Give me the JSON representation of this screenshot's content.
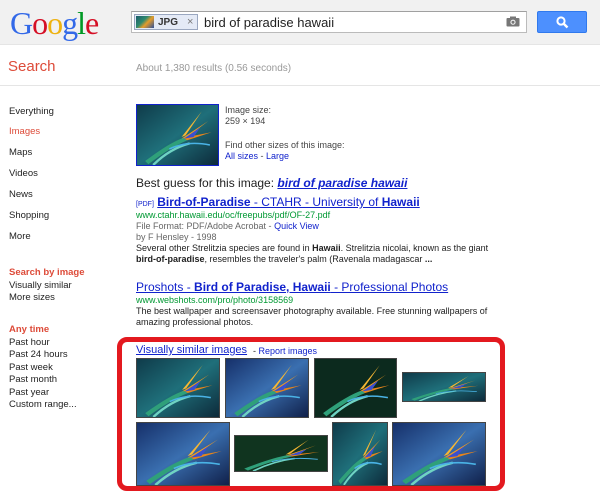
{
  "header": {
    "logo_letters": [
      {
        "ch": "G",
        "color": "#3369e8"
      },
      {
        "ch": "o",
        "color": "#d50f25"
      },
      {
        "ch": "o",
        "color": "#eeb211"
      },
      {
        "ch": "g",
        "color": "#3369e8"
      },
      {
        "ch": "l",
        "color": "#009925"
      },
      {
        "ch": "e",
        "color": "#d50f25"
      }
    ],
    "chip_label": "JPG",
    "chip_close": "×",
    "query": "bird of paradise hawaii"
  },
  "page_title": "Search",
  "results_count": "About 1,380 results (0.56 seconds)",
  "nav": {
    "items": [
      "Everything",
      "Images",
      "Maps",
      "Videos",
      "News",
      "Shopping",
      "More"
    ],
    "search_by_image_heading": "Search by image",
    "search_by_image_items": [
      "Visually similar",
      "More sizes"
    ],
    "any_time_heading": "Any time",
    "time_items": [
      "Past hour",
      "Past 24 hours",
      "Past week",
      "Past month",
      "Past year",
      "Custom range..."
    ]
  },
  "image_info": {
    "size_label": "Image size:",
    "size_value": "259 × 194",
    "find_other": "Find other sizes of this image:",
    "all_sizes": "All sizes",
    "separator": " - ",
    "large": "Large"
  },
  "best_guess": {
    "prefix": "Best guess for this image:",
    "link": "bird of paradise hawaii"
  },
  "results": [
    {
      "pdf_tag": "[PDF]",
      "title_bold": "Bird-of-Paradise",
      "title_rest": " - CTAHR - University of ",
      "title_bold2": "Hawaii",
      "url": "www.ctahr.hawaii.edu/oc/freepubs/pdf/OF-27.pdf",
      "meta_format": "File Format: PDF/Adobe Acrobat - ",
      "meta_quickview": "Quick View",
      "meta_author": "by F Hensley - 1998",
      "snippet_1a": "Several other Strelitzia species are found in ",
      "snippet_1b": "Hawaii",
      "snippet_1c": ". Strelitzia nicolai, known as the giant",
      "snippet_2a": "bird-of-paradise",
      "snippet_2b": ", resembles the traveler's palm (Ravenala madagascar ",
      "snippet_2c": "..."
    },
    {
      "title_a": "Proshots - ",
      "title_bold": "Bird of Paradise, Hawaii",
      "title_rest": " - Professional Photos",
      "url": "www.webshots.com/pro/photo/3158569",
      "snippet_1": "The best wallpaper and screensaver photography available. Free stunning wallpapers of",
      "snippet_2": "amazing professional photos."
    }
  ],
  "similar": {
    "title": "Visually similar images",
    "separator": " - ",
    "report": "Report images"
  },
  "colors": {
    "link": "#1122cc",
    "url_green": "#009933",
    "accent_red": "#dd4b39",
    "highlight_box": "#e3191f",
    "search_button": "#4d90fe"
  }
}
